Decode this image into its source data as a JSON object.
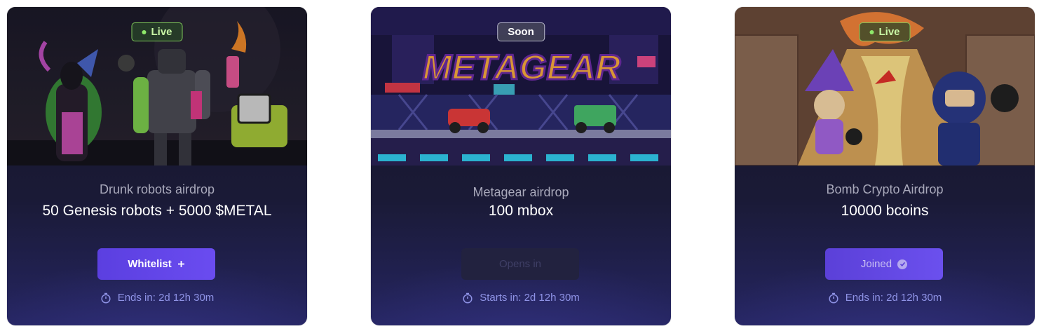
{
  "cards": [
    {
      "status": "Live",
      "subtitle": "Drunk robots airdrop",
      "headline": "50 Genesis robots + 5000 $METAL",
      "button_label": "Whitelist",
      "button_icon": "plus-icon",
      "timer_prefix": "Ends in:",
      "timer_value": "2d 12h 30m"
    },
    {
      "status": "Soon",
      "banner_logo_text": "METAGEAR",
      "subtitle": "Metagear airdrop",
      "headline": "100 mbox",
      "button_label": "Opens in",
      "timer_prefix": "Starts in:",
      "timer_value": "2d 12h 30m"
    },
    {
      "status": "Live",
      "subtitle": "Bomb Crypto Airdrop",
      "headline": "10000 bcoins",
      "button_label": "Joined",
      "button_icon": "check-circle-icon",
      "timer_prefix": "Ends in:",
      "timer_value": "2d 12h 30m"
    }
  ],
  "colors": {
    "live_badge": "#7fc95a",
    "primary_button": "#5b3fe0",
    "timer_text": "#8f93e6"
  }
}
